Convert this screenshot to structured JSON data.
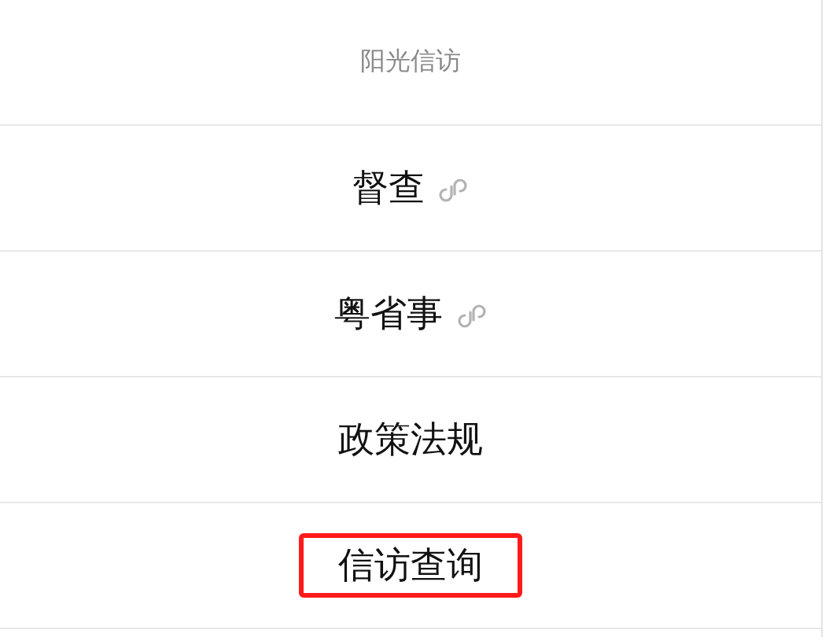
{
  "menu": {
    "title": "阳光信访",
    "items": [
      {
        "label": "督查",
        "mini_program": true,
        "highlighted": false
      },
      {
        "label": "粤省事",
        "mini_program": true,
        "highlighted": false
      },
      {
        "label": "政策法规",
        "mini_program": false,
        "highlighted": false
      },
      {
        "label": "信访查询",
        "mini_program": false,
        "highlighted": true
      }
    ]
  }
}
